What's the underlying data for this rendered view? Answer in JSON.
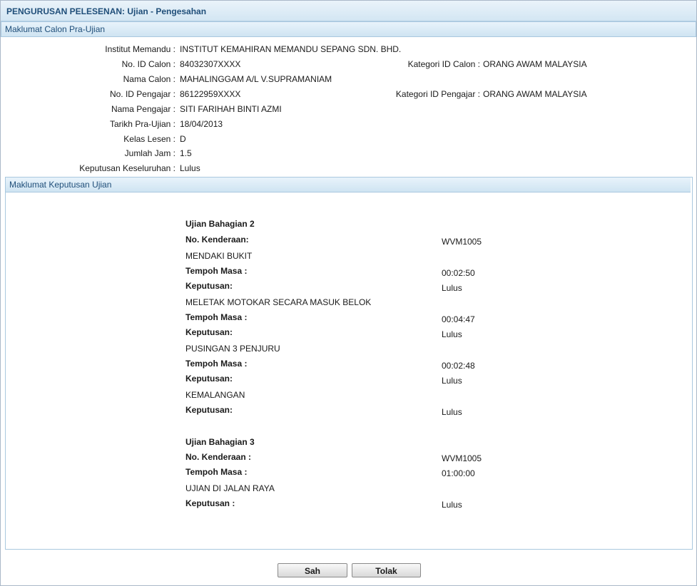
{
  "page": {
    "title": "PENGURUSAN PELESENAN: Ujian - Pengesahan"
  },
  "calon": {
    "section_title": "Maklumat Calon Pra-Ujian",
    "fields": {
      "institut": {
        "label": "Institut Memandu :",
        "value": "INSTITUT KEMAHIRAN MEMANDU SEPANG SDN. BHD."
      },
      "id_calon": {
        "label": "No. ID Calon :",
        "value": "84032307XXXX"
      },
      "kategori_calon": {
        "label": "Kategori ID Calon :",
        "value": "ORANG AWAM MALAYSIA"
      },
      "nama_calon": {
        "label": "Nama Calon :",
        "value": "MAHALINGGAM A/L V.SUPRAMANIAM"
      },
      "id_pengajar": {
        "label": "No. ID Pengajar :",
        "value": "86122959XXXX"
      },
      "kategori_pengajar": {
        "label": "Kategori ID Pengajar :",
        "value": "ORANG AWAM MALAYSIA"
      },
      "nama_pengajar": {
        "label": "Nama Pengajar :",
        "value": "SITI FARIHAH BINTI AZMI"
      },
      "tarikh": {
        "label": "Tarikh Pra-Ujian :",
        "value": "18/04/2013"
      },
      "kelas": {
        "label": "Kelas Lesen :",
        "value": "D"
      },
      "jam": {
        "label": "Jumlah Jam :",
        "value": "1.5"
      },
      "keputusan": {
        "label": "Keputusan Keseluruhan :",
        "value": "Lulus"
      }
    }
  },
  "keputusan": {
    "section_title": "Maklumat Keputusan Ujian",
    "bahagian2": {
      "heading": "Ujian Bahagian 2",
      "kenderaan_label": "No. Kenderaan:",
      "kenderaan_value": "WVM1005",
      "items": [
        {
          "name": "MENDAKI BUKIT",
          "masa_label": "Tempoh Masa :",
          "masa_value": "00:02:50",
          "keputusan_label": "Keputusan:",
          "keputusan_value": "Lulus"
        },
        {
          "name": "MELETAK MOTOKAR SECARA MASUK BELOK",
          "masa_label": "Tempoh Masa :",
          "masa_value": "00:04:47",
          "keputusan_label": "Keputusan:",
          "keputusan_value": "Lulus"
        },
        {
          "name": "PUSINGAN 3 PENJURU",
          "masa_label": "Tempoh Masa :",
          "masa_value": "00:02:48",
          "keputusan_label": "Keputusan:",
          "keputusan_value": "Lulus"
        },
        {
          "name": "KEMALANGAN",
          "keputusan_label": "Keputusan:",
          "keputusan_value": "Lulus"
        }
      ]
    },
    "bahagian3": {
      "heading": "Ujian Bahagian 3",
      "kenderaan_label": "No. Kenderaan :",
      "kenderaan_value": "WVM1005",
      "masa_label": "Tempoh Masa :",
      "masa_value": "01:00:00",
      "item_name": "UJIAN DI JALAN RAYA",
      "keputusan_label": "Keputusan :",
      "keputusan_value": "Lulus"
    }
  },
  "buttons": {
    "sah": "Sah",
    "tolak": "Tolak"
  }
}
